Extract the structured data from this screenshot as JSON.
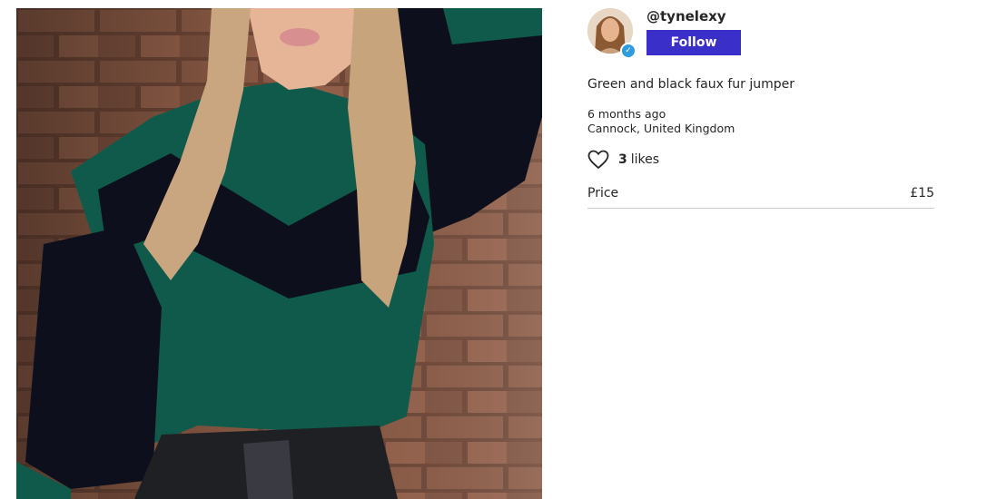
{
  "listing": {
    "seller": {
      "username": "@tynelexy",
      "verified": true,
      "follow_label": "Follow"
    },
    "description": "Green and black faux fur jumper",
    "posted": "6 months ago",
    "location": "Cannock, United Kingdom",
    "likes": {
      "count": "3",
      "label": "likes"
    },
    "price": {
      "label": "Price",
      "value": "£15"
    }
  },
  "icons": {
    "like": "heart-icon",
    "verified": "check-badge-icon"
  },
  "colors": {
    "follow_button": "#3b2fc9",
    "verified_badge": "#2f9be0",
    "jumper_green": "#0f5a4a",
    "faux_fur_black": "#0d0f1c"
  }
}
